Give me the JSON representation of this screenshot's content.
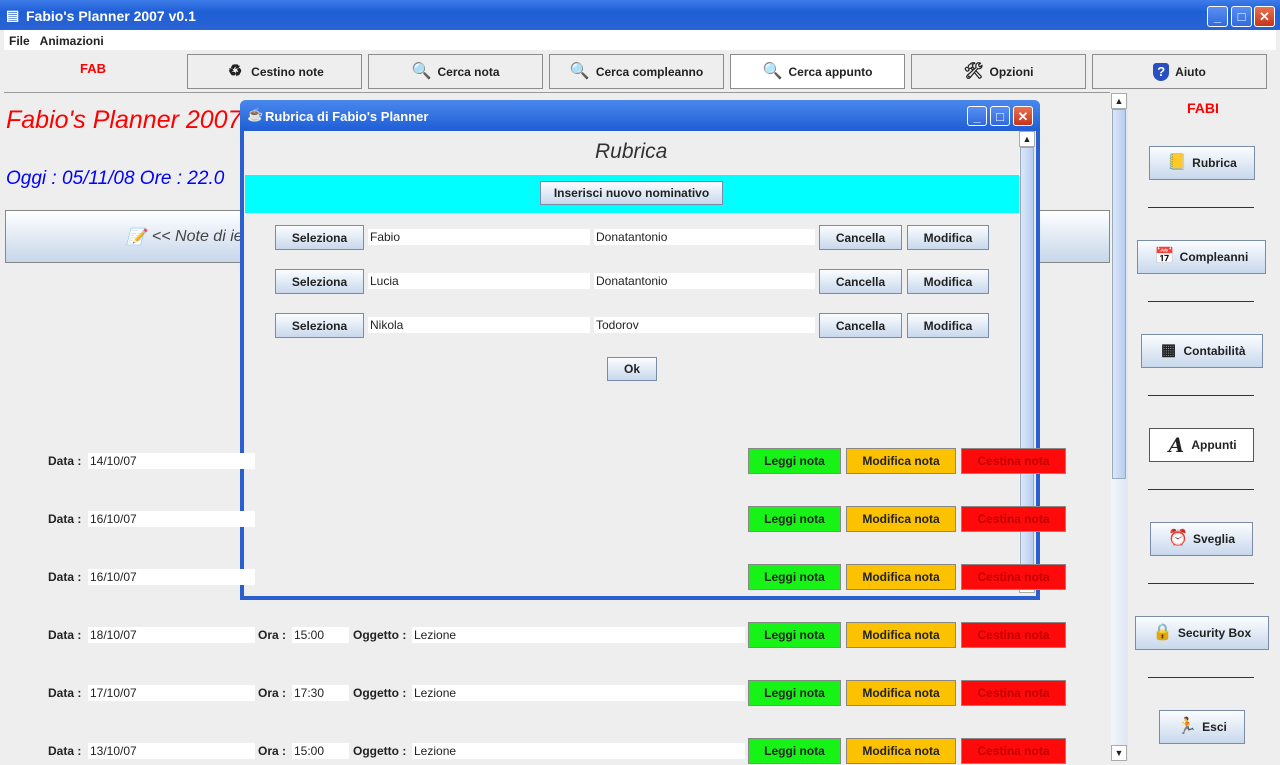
{
  "window": {
    "title": "Fabio's Planner 2007  v0.1",
    "minimize": "_",
    "maximize": "□",
    "close": "✕"
  },
  "menu": [
    "File",
    "Animazioni"
  ],
  "toolbar": {
    "user": "FAB",
    "buttons": [
      {
        "label": "Cestino note",
        "icon": "recycle-bin-icon",
        "glyph": "♻"
      },
      {
        "label": "Cerca nota",
        "icon": "magnifier-icon",
        "glyph": "🔍"
      },
      {
        "label": "Cerca compleanno",
        "icon": "search-window-icon",
        "glyph": "🔍"
      },
      {
        "label": "Cerca appunto",
        "icon": "magnifier-check-icon",
        "glyph": "🔍"
      },
      {
        "label": "Opzioni",
        "icon": "tools-icon",
        "glyph": "🛠"
      },
      {
        "label": "Aiuto",
        "icon": "help-shield-icon",
        "glyph": "?"
      }
    ]
  },
  "main": {
    "heading": "Fabio's Planner 2007",
    "today": "Oggi : 05/11/08  Ore : 22.0",
    "banner": "<< Note di ie",
    "labels": {
      "data": "Data :",
      "ora": "Ora :",
      "oggetto": "Oggetto :"
    },
    "actions": {
      "read": "Leggi nota",
      "edit": "Modifica nota",
      "trash": "Cestina nota"
    },
    "notes": [
      {
        "data": "14/10/07"
      },
      {
        "data": "16/10/07"
      },
      {
        "data": "16/10/07"
      },
      {
        "data": "18/10/07",
        "ora": "15:00",
        "oggetto": "Lezione"
      },
      {
        "data": "17/10/07",
        "ora": "17:30",
        "oggetto": "Lezione"
      },
      {
        "data": "13/10/07",
        "ora": "15:00",
        "oggetto": "Lezione"
      }
    ]
  },
  "sidebar": {
    "user": "FABI",
    "items": [
      {
        "label": "Rubrica",
        "icon": "address-book-icon",
        "glyph": "📒"
      },
      {
        "label": "Compleanni",
        "icon": "calendar-icon",
        "glyph": "📅"
      },
      {
        "label": "Contabilità",
        "icon": "ledger-icon",
        "glyph": "▦"
      },
      {
        "label": "Appunti",
        "icon": "letter-a-icon",
        "glyph": "A"
      },
      {
        "label": "Sveglia",
        "icon": "alarm-clock-icon",
        "glyph": "⏰"
      },
      {
        "label": "Security Box",
        "icon": "padlock-icon",
        "glyph": "🔒"
      },
      {
        "label": "Esci",
        "icon": "running-man-icon",
        "glyph": "🏃"
      }
    ]
  },
  "dialog": {
    "title": "Rubrica di Fabio's Planner",
    "heading": "Rubrica",
    "add": "Inserisci nuovo nominativo",
    "select": "Seleziona",
    "delete": "Cancella",
    "edit": "Modifica",
    "ok": "Ok",
    "contacts": [
      {
        "name": "Fabio",
        "surname": "Donatantonio"
      },
      {
        "name": "Lucia",
        "surname": "Donatantonio"
      },
      {
        "name": "Nikola",
        "surname": "Todorov"
      }
    ]
  },
  "colors": {
    "accent_red": "#ff0000",
    "accent_blue": "#0000ff",
    "cyan": "#00ffff",
    "read": "#17f217",
    "edit": "#fcc200",
    "trash": "#ff0a0a"
  }
}
